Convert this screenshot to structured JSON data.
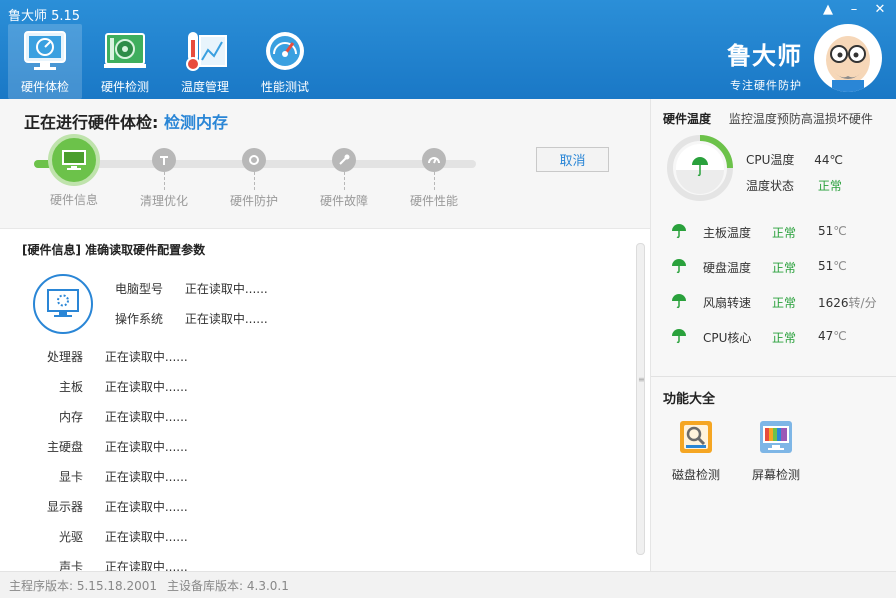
{
  "window": {
    "title": "鲁大师 5.15",
    "controls": [
      "▲",
      "–",
      "✕"
    ]
  },
  "nav": [
    {
      "label": "硬件体检",
      "icon": "monitor-check-icon",
      "active": true
    },
    {
      "label": "硬件检测",
      "icon": "circuit-board-icon",
      "active": false
    },
    {
      "label": "温度管理",
      "icon": "thermometer-icon",
      "active": false
    },
    {
      "label": "性能测试",
      "icon": "speedometer-icon",
      "active": false
    }
  ],
  "brand": {
    "name": "鲁大师",
    "slogan": "专注硬件防护"
  },
  "task": {
    "title": "正在进行硬件体检:",
    "subtitle": "检测内存",
    "cancel_label": "取消",
    "steps": [
      {
        "label": "硬件信息",
        "state": "done"
      },
      {
        "label": "清理优化",
        "state": "todo"
      },
      {
        "label": "硬件防护",
        "state": "todo"
      },
      {
        "label": "硬件故障",
        "state": "todo"
      },
      {
        "label": "硬件性能",
        "state": "todo"
      }
    ]
  },
  "info": {
    "section_title": "[硬件信息] 准确读取硬件配置参数",
    "computer_model": {
      "label": "电脑型号",
      "value": "正在读取中......"
    },
    "os": {
      "label": "操作系统",
      "value": "正在读取中......"
    },
    "rows": [
      {
        "label": "处理器",
        "value": "正在读取中......"
      },
      {
        "label": "主板",
        "value": "正在读取中......"
      },
      {
        "label": "内存",
        "value": "正在读取中......"
      },
      {
        "label": "主硬盘",
        "value": "正在读取中......"
      },
      {
        "label": "显卡",
        "value": "正在读取中......"
      },
      {
        "label": "显示器",
        "value": "正在读取中......"
      },
      {
        "label": "光驱",
        "value": "正在读取中......"
      },
      {
        "label": "声卡",
        "value": "正在读取中......"
      }
    ]
  },
  "temps": {
    "title": "硬件温度",
    "hint": "监控温度预防高温损坏硬件",
    "cpu_temp_label": "CPU温度",
    "cpu_temp_value": "44℃",
    "temp_status_label": "温度状态",
    "temp_status_value": "正常",
    "colors": {
      "ok": "#2aa13c",
      "accent": "#2a86d6"
    },
    "sensors": [
      {
        "name": "主板温度",
        "status": "正常",
        "value": "51",
        "unit": "℃"
      },
      {
        "name": "硬盘温度",
        "status": "正常",
        "value": "51",
        "unit": "℃"
      },
      {
        "name": "风扇转速",
        "status": "正常",
        "value": "1626",
        "unit": "转/分"
      },
      {
        "name": "CPU核心",
        "status": "正常",
        "value": "47",
        "unit": "℃"
      }
    ]
  },
  "functions": {
    "title": "功能大全",
    "items": [
      {
        "label": "磁盘检测",
        "icon": "disk-check-icon"
      },
      {
        "label": "屏幕检测",
        "icon": "screen-check-icon"
      }
    ]
  },
  "footer": {
    "program_version": "主程序版本: 5.15.18.2001",
    "db_version": "主设备库版本: 4.3.0.1"
  }
}
